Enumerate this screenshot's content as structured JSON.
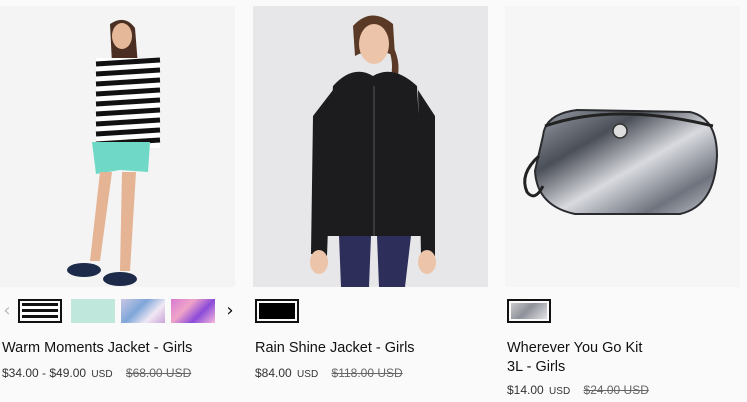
{
  "products": [
    {
      "name": "Warm Moments Jacket - Girls",
      "price": "$34.00 - $49.00",
      "currency": "USD",
      "original_price": "$68.00 USD",
      "swatch_colors": [
        "#111111",
        "#bfe7dc",
        "#c9c6e4",
        "#d77ad2"
      ]
    },
    {
      "name": "Rain Shine Jacket - Girls",
      "price": "$84.00",
      "currency": "USD",
      "original_price": "$118.00 USD",
      "swatch_colors": [
        "#000000"
      ]
    },
    {
      "name_line1": "Wherever You Go Kit",
      "name_line2": "3L - Girls",
      "price": "$14.00",
      "currency": "USD",
      "original_price": "$24.00 USD",
      "swatch_colors": [
        "#c8c9cc"
      ]
    }
  ],
  "carousel": {
    "prev": "‹",
    "next": "›"
  }
}
